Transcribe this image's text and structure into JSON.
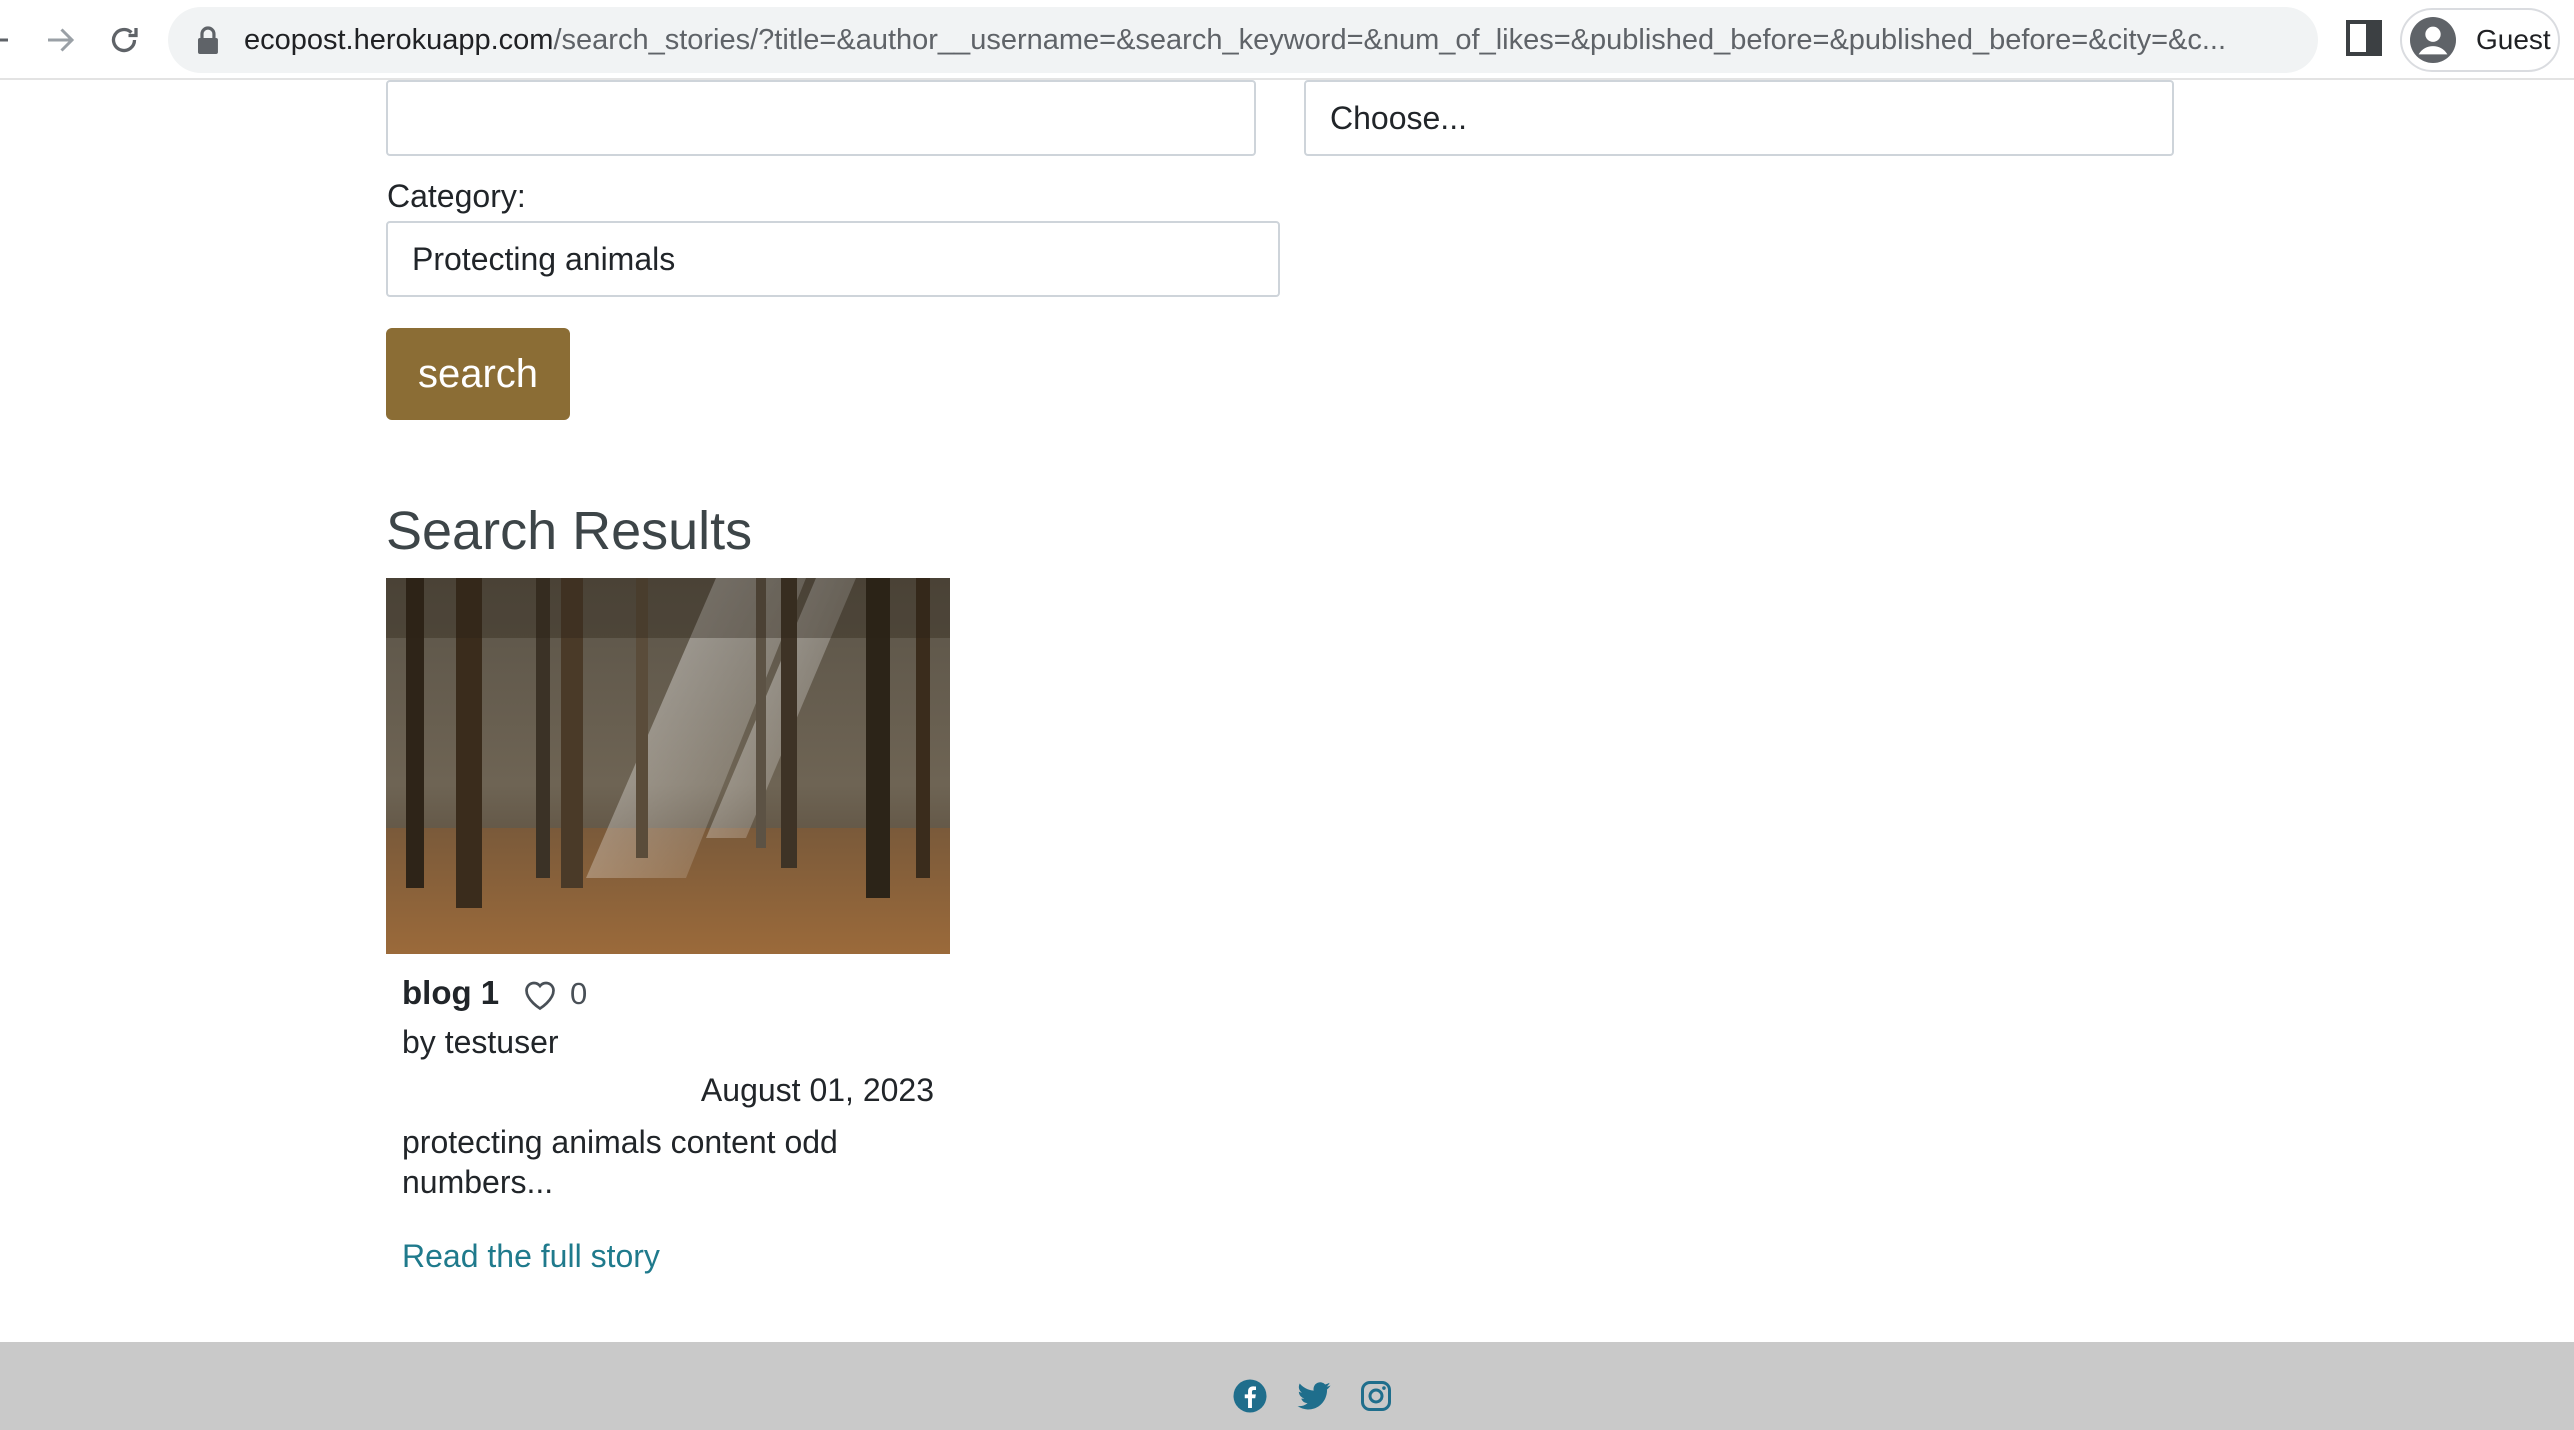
{
  "browser": {
    "url_host": "ecopost.herokuapp.com",
    "url_path": "/search_stories/?title=&author__username=&search_keyword=&num_of_likes=&published_before=&published_before=&city=&c...",
    "profile_label": "Guest"
  },
  "form": {
    "text_field_value": "",
    "select_value": "Choose...",
    "category_label": "Category:",
    "category_value": "Protecting animals",
    "search_label": "search"
  },
  "results": {
    "heading": "Search Results",
    "cards": [
      {
        "title": "blog 1",
        "likes": "0",
        "byline": "by testuser",
        "date": "August 01, 2023",
        "excerpt": "protecting animals content odd numbers...",
        "link_text": "Read the full story"
      }
    ]
  },
  "footer": {
    "icons": [
      "facebook-icon",
      "twitter-icon",
      "instagram-icon"
    ]
  },
  "colors": {
    "button": "#8b6d35",
    "link": "#1f7a8c",
    "footer_bg": "#c9c9c9",
    "social_icon": "#1f6e8c"
  }
}
